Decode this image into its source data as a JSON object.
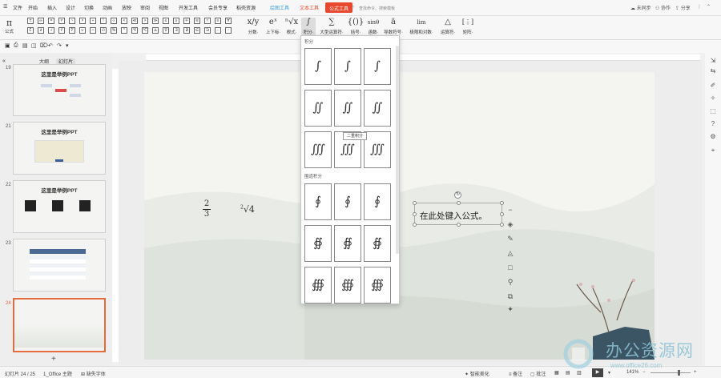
{
  "menubar": {
    "file": "文件",
    "items": [
      "开始",
      "插入",
      "设计",
      "切换",
      "动画",
      "放映",
      "审阅",
      "视图",
      "开发工具",
      "会员专享",
      "稻壳资源"
    ],
    "context_tabs": [
      "绘图工具",
      "文本工具"
    ],
    "active_tab": "公式工具",
    "search_placeholder": "查找命令、搜索模板",
    "unsynced": "未同步",
    "collab": "协作",
    "share": "分享"
  },
  "ribbon": {
    "formula_label": "公式",
    "symbols": [
      "±",
      "∞",
      "=",
      "≠",
      "~",
      "×",
      "÷",
      "!",
      "∝",
      "<",
      "≪",
      ">",
      "≫",
      "≤",
      "≥",
      "∓",
      "≅",
      "≈",
      "≡",
      "∀",
      "∁",
      "∂",
      "√",
      "∛",
      "∜",
      "∪",
      "∩",
      "∅",
      "%",
      "°",
      "℉",
      "℃",
      "∆",
      "∇",
      "∃",
      "∄",
      "∈",
      "∋",
      "←",
      "↑"
    ],
    "buttons": [
      {
        "icon": "x/y",
        "label": "分数·"
      },
      {
        "icon": "eˣ",
        "label": "上下标·"
      },
      {
        "icon": "ⁿ√x",
        "label": "根式·"
      },
      {
        "icon": "∫",
        "label": "积分·"
      },
      {
        "icon": "∑",
        "label": "大型运算符·"
      },
      {
        "icon": "{()}",
        "label": "括号·"
      },
      {
        "icon": "sinθ",
        "label": "函数·"
      },
      {
        "icon": "ä",
        "label": "导数符号·"
      },
      {
        "icon": "lim",
        "label": "极限和对数·"
      },
      {
        "icon": "△",
        "label": "运算符·"
      },
      {
        "icon": "[⋮]",
        "label": "矩阵·"
      }
    ]
  },
  "left_panel": {
    "tab_outline": "大纲",
    "tab_slides": "幻灯片",
    "slides": [
      {
        "num": "19",
        "title": "这里是举例PPT"
      },
      {
        "num": "21",
        "title": "这里是举例PPT"
      },
      {
        "num": "22",
        "title": "这里是举例PPT"
      },
      {
        "num": "23",
        "title": ""
      },
      {
        "num": "24",
        "title": ""
      }
    ]
  },
  "dropdown": {
    "section_integral": "积分",
    "section_contour": "围道积分",
    "tooltip": "二重积分",
    "integrals": [
      "∫",
      "∫",
      "∫",
      "∬",
      "∬",
      "∬",
      "∭",
      "∭",
      "∭"
    ],
    "contours": [
      "∮",
      "∮",
      "∮",
      "∯",
      "∯",
      "∯",
      "∰",
      "∰",
      "∰"
    ]
  },
  "slide": {
    "frac_num": "2",
    "frac_den": "3",
    "root_index": "2",
    "root_body": "√4",
    "eq_placeholder": "在此处键入公式。"
  },
  "statusbar": {
    "slide_count": "幻灯片 24 / 25",
    "theme": "1_Office 主题",
    "missing_font": "缺失字体",
    "smart": "智能美化",
    "notes": "备注",
    "comments": "批注",
    "zoom": "141%"
  },
  "watermark": {
    "cn": "办公资源网",
    "url": "www.office26.com"
  }
}
